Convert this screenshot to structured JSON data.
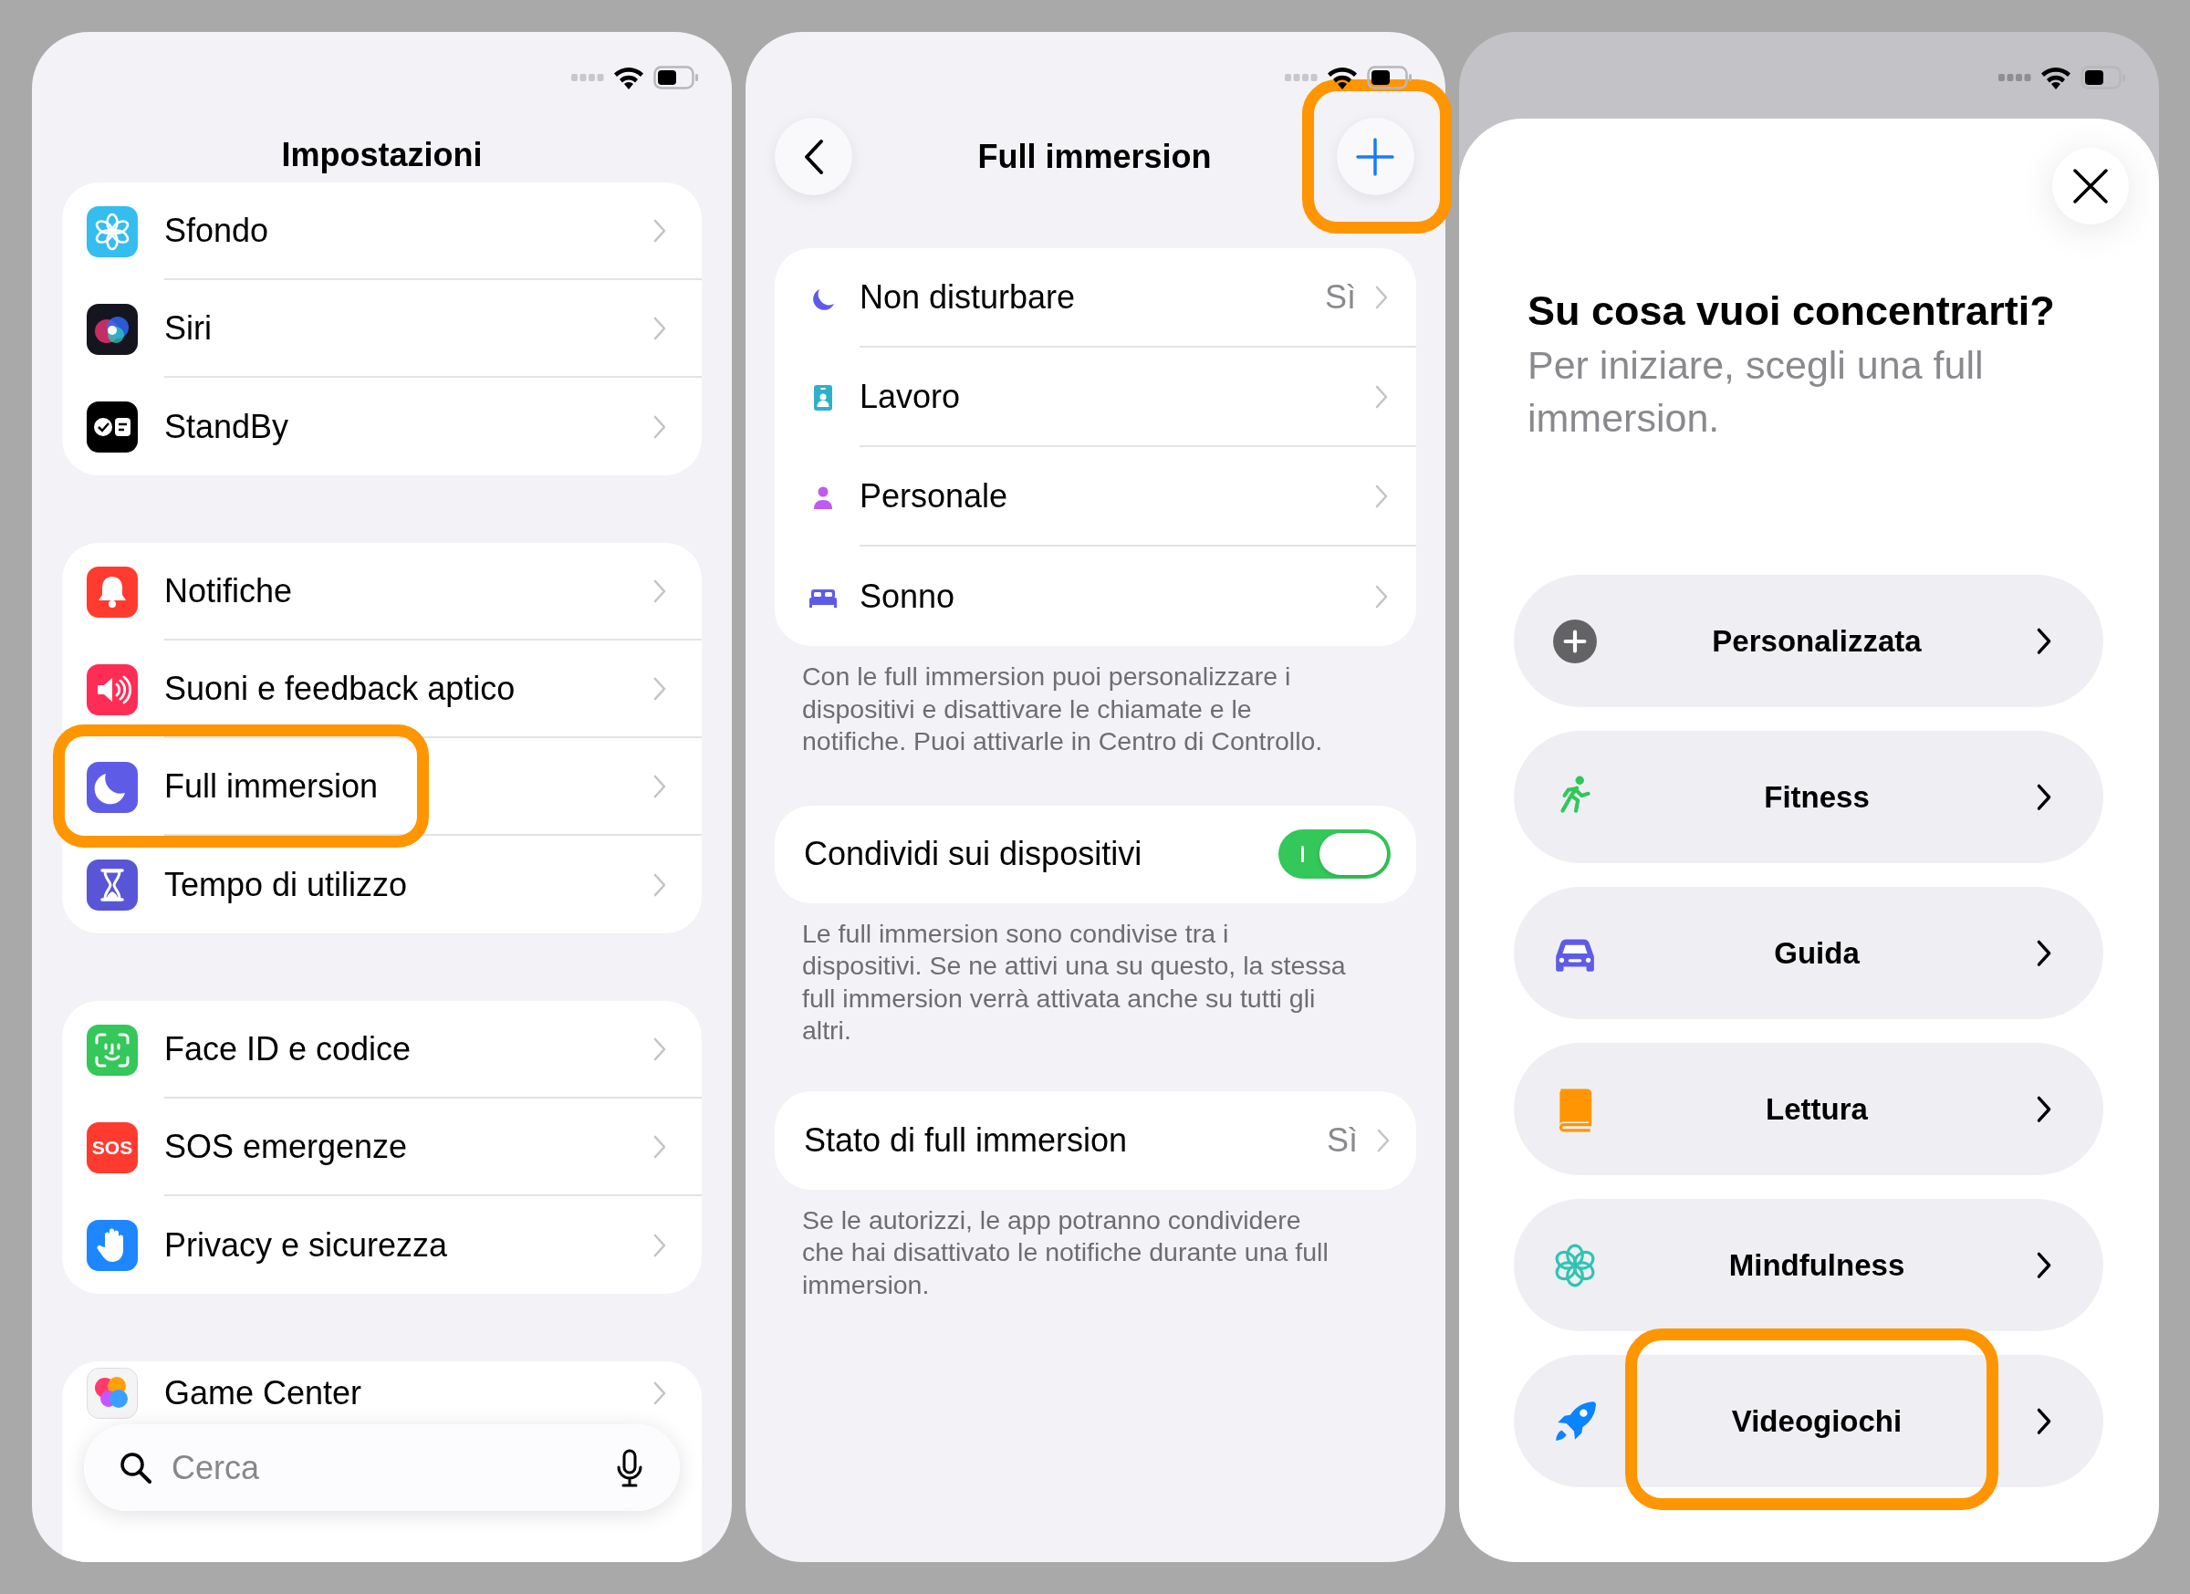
{
  "settings": {
    "title": "Impostazioni",
    "groups": [
      [
        {
          "label": "Sfondo",
          "kind": "wallpaper",
          "highlighted": false
        },
        {
          "label": "Siri",
          "kind": "siri",
          "highlighted": false
        },
        {
          "label": "StandBy",
          "kind": "standby",
          "highlighted": false
        }
      ],
      [
        {
          "label": "Notifiche",
          "kind": "notifications",
          "highlighted": false
        },
        {
          "label": "Suoni e feedback aptico",
          "kind": "sounds",
          "highlighted": false
        },
        {
          "label": "Full immersion",
          "kind": "focus",
          "highlighted": true
        },
        {
          "label": "Tempo di utilizzo",
          "kind": "screentime",
          "highlighted": false
        }
      ],
      [
        {
          "label": "Face ID e codice",
          "kind": "faceid",
          "highlighted": false
        },
        {
          "label": "SOS emergenze",
          "kind": "sos",
          "badge": "SOS",
          "highlighted": false
        },
        {
          "label": "Privacy e sicurezza",
          "kind": "privacy",
          "highlighted": false
        }
      ],
      [
        {
          "label": "Game Center",
          "kind": "gamecenter",
          "highlighted": false
        }
      ]
    ],
    "search": {
      "placeholder": "Cerca"
    }
  },
  "focus": {
    "title": "Full immersion",
    "add_highlighted": true,
    "modes": [
      {
        "label": "Non disturbare",
        "kind": "moon",
        "value": "Sì"
      },
      {
        "label": "Lavoro",
        "kind": "badge"
      },
      {
        "label": "Personale",
        "kind": "person"
      },
      {
        "label": "Sonno",
        "kind": "bed"
      }
    ],
    "modes_footer": "Con le full immersion puoi personalizzare i dispositivi e disattivare le chiamate e le notifiche. Puoi attivarle in Centro di Controllo.",
    "share": {
      "label": "Condividi sui dispositivi",
      "on": true
    },
    "share_footer": "Le full immersion sono condivise tra i dispositivi. Se ne attivi una su questo, la stessa full immersion verrà attivata anche su tutti gli altri.",
    "status": {
      "label": "Stato di full immersion",
      "value": "Sì"
    },
    "status_footer": "Se le autorizzi, le app potranno condividere che hai disattivato le notifiche durante una full immersion."
  },
  "picker": {
    "heading": "Su cosa vuoi concentrarti?",
    "subtitle": "Per iniziare, scegli una full immersion.",
    "options": [
      {
        "label": "Personalizzata",
        "kind": "plus",
        "highlighted": false
      },
      {
        "label": "Fitness",
        "kind": "runner",
        "highlighted": false
      },
      {
        "label": "Guida",
        "kind": "car",
        "highlighted": false
      },
      {
        "label": "Lettura",
        "kind": "book",
        "highlighted": false
      },
      {
        "label": "Mindfulness",
        "kind": "flower",
        "highlighted": false
      },
      {
        "label": "Videogiochi",
        "kind": "rocket",
        "highlighted": true
      }
    ]
  }
}
